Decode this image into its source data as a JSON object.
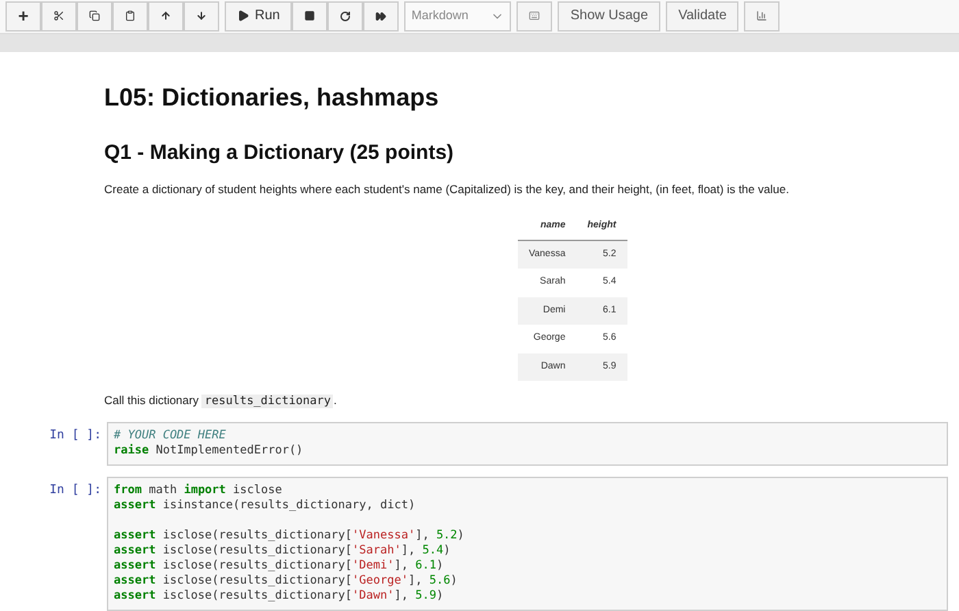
{
  "toolbar": {
    "items": [
      {
        "kind": "plus",
        "label": "+"
      },
      {
        "kind": "cut"
      },
      {
        "kind": "copy"
      },
      {
        "kind": "paste"
      },
      {
        "kind": "up"
      },
      {
        "kind": "down"
      },
      {
        "kind": "run",
        "label": "Run"
      },
      {
        "kind": "stop"
      },
      {
        "kind": "restart"
      },
      {
        "kind": "forward"
      },
      {
        "kind": "select",
        "label": "Markdown"
      },
      {
        "kind": "keyboard"
      },
      {
        "kind": "text",
        "label": "Show Usage"
      },
      {
        "kind": "text",
        "label": "Validate"
      },
      {
        "kind": "chart"
      }
    ]
  },
  "markdown_cell": {
    "title": "L05: Dictionaries, hashmaps",
    "heading": "Q1 - Making a Dictionary (25 points)",
    "description": "Create a dictionary of student heights where each student's name (Capitalized) is the key, and their height, (in feet, float) is the value.",
    "table": {
      "columns": [
        "name",
        "height"
      ],
      "rows": [
        [
          "Vanessa",
          "5.2"
        ],
        [
          "Sarah",
          "5.4"
        ],
        [
          "Demi",
          "6.1"
        ],
        [
          "George",
          "5.6"
        ],
        [
          "Dawn",
          "5.9"
        ]
      ]
    },
    "note": {
      "text": "Call this dictionary",
      "code": "results_dictionary",
      "end": "."
    }
  },
  "code_cells": [
    {
      "prompt": "In [ ]:",
      "blocks": [
        [
          [
            {
              "kind": "comment",
              "text": "# YOUR CODE HERE"
            }
          ],
          [
            {
              "kind": "keyword",
              "text": "raise"
            },
            {
              "kind": "plain",
              "text": " NotImplementedError()"
            }
          ]
        ]
      ]
    },
    {
      "prompt": "In [ ]:",
      "blocks": [
        [
          [
            {
              "kind": "keyword",
              "text": "from"
            },
            {
              "kind": "plain",
              "text": " math "
            },
            {
              "kind": "keyword",
              "text": "import"
            },
            {
              "kind": "plain",
              "text": " isclose"
            }
          ],
          [
            {
              "kind": "keyword",
              "text": "assert"
            },
            {
              "kind": "plain",
              "text": " isinstance(results_dictionary, dict)"
            }
          ]
        ],
        [
          [
            {
              "kind": "keyword",
              "text": "assert"
            },
            {
              "kind": "plain",
              "text": " isclose(results_dictionary["
            },
            {
              "kind": "string",
              "text": "'Vanessa'"
            },
            {
              "kind": "plain",
              "text": "], "
            },
            {
              "kind": "number",
              "text": "5.2"
            },
            {
              "kind": "plain",
              "text": ")"
            }
          ],
          [
            {
              "kind": "keyword",
              "text": "assert"
            },
            {
              "kind": "plain",
              "text": " isclose(results_dictionary["
            },
            {
              "kind": "string",
              "text": "'Sarah'"
            },
            {
              "kind": "plain",
              "text": "], "
            },
            {
              "kind": "number",
              "text": "5.4"
            },
            {
              "kind": "plain",
              "text": ")"
            }
          ],
          [
            {
              "kind": "keyword",
              "text": "assert"
            },
            {
              "kind": "plain",
              "text": " isclose(results_dictionary["
            },
            {
              "kind": "string",
              "text": "'Demi'"
            },
            {
              "kind": "plain",
              "text": "], "
            },
            {
              "kind": "number",
              "text": "6.1"
            },
            {
              "kind": "plain",
              "text": ")"
            }
          ],
          [
            {
              "kind": "keyword",
              "text": "assert"
            },
            {
              "kind": "plain",
              "text": " isclose(results_dictionary["
            },
            {
              "kind": "string",
              "text": "'George'"
            },
            {
              "kind": "plain",
              "text": "], "
            },
            {
              "kind": "number",
              "text": "5.6"
            },
            {
              "kind": "plain",
              "text": ")"
            }
          ],
          [
            {
              "kind": "keyword",
              "text": "assert"
            },
            {
              "kind": "plain",
              "text": " isclose(results_dictionary["
            },
            {
              "kind": "string",
              "text": "'Dawn'"
            },
            {
              "kind": "plain",
              "text": "], "
            },
            {
              "kind": "number",
              "text": "5.9"
            },
            {
              "kind": "plain",
              "text": ")"
            }
          ]
        ]
      ]
    }
  ]
}
